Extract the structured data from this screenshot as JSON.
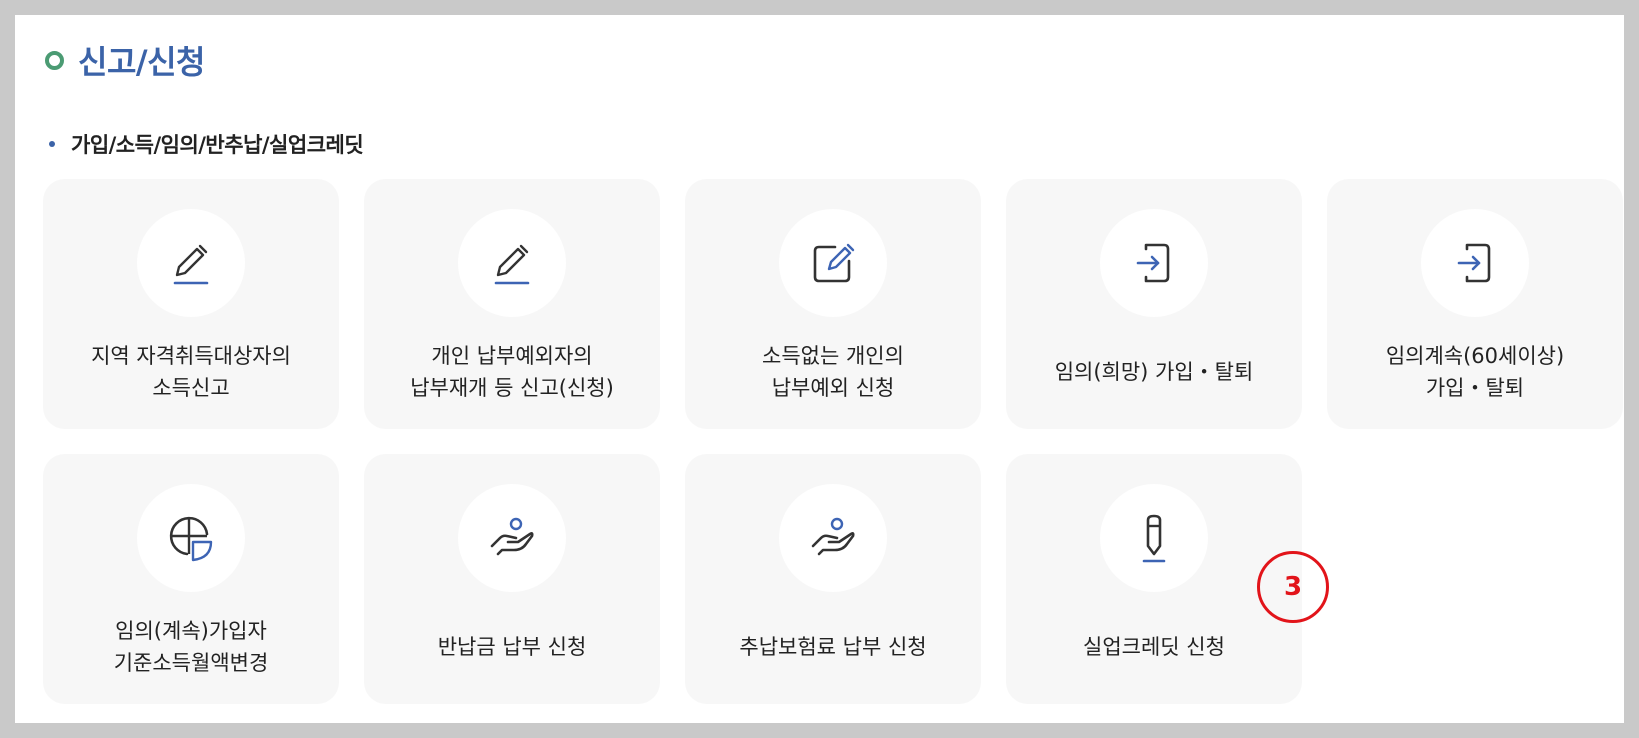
{
  "page": {
    "title": "신고/신청",
    "section_title": "가입/소득/임의/반추납/실업크레딧"
  },
  "cards": [
    {
      "label": "지역 자격취득대상자의\n소득신고",
      "icon": "pencil-icon"
    },
    {
      "label": "개인 납부예외자의\n납부재개 등 신고(신청)",
      "icon": "pencil-icon"
    },
    {
      "label": "소득없는 개인의\n납부예외 신청",
      "icon": "edit-square-icon"
    },
    {
      "label": "임의(희망) 가입・탈퇴",
      "icon": "sign-in-icon"
    },
    {
      "label": "임의계속(60세이상)\n가입・탈퇴",
      "icon": "sign-in-icon"
    },
    {
      "label": "임의(계속)가입자\n기준소득월액변경",
      "icon": "globe-pie-icon"
    },
    {
      "label": "반납금 납부 신청",
      "icon": "hand-person-icon"
    },
    {
      "label": "추납보험료 납부 신청",
      "icon": "hand-person-icon"
    },
    {
      "label": "실업크레딧 신청",
      "icon": "pen-icon"
    }
  ],
  "annotation": {
    "number": "3"
  },
  "colors": {
    "accent": "#3b63a8",
    "icon_stroke": "#333333",
    "icon_accent": "#3d64b4",
    "annotation": "#e2141a"
  }
}
